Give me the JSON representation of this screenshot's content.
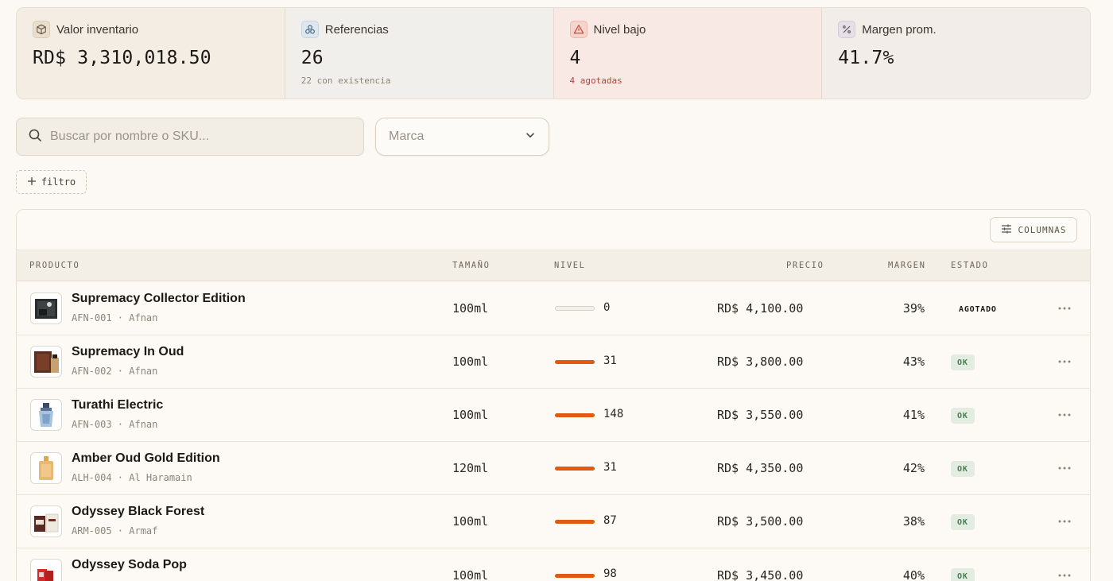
{
  "stats": [
    {
      "label": "Valor inventario",
      "value": "RD$ 3,310,018.50",
      "sub": "",
      "icon": "box-icon"
    },
    {
      "label": "Referencias",
      "value": "26",
      "sub": "22 con existencia",
      "icon": "boxes-icon"
    },
    {
      "label": "Nivel bajo",
      "value": "4",
      "sub": "4 agotadas",
      "icon": "alert-triangle-icon"
    },
    {
      "label": "Margen prom.",
      "value": "41.7%",
      "sub": "",
      "icon": "percent-icon"
    }
  ],
  "search": {
    "placeholder": "Buscar por nombre o SKU...",
    "icon": "search-icon"
  },
  "brand_select": {
    "placeholder": "Marca",
    "icon": "chevron-down-icon"
  },
  "filter_button": {
    "label": "filtro",
    "icon": "plus-icon"
  },
  "columns_button": {
    "label": "COLUMNAS",
    "icon": "sliders-icon"
  },
  "table": {
    "headers": {
      "product": "PRODUCTO",
      "size": "TAMAÑO",
      "level": "NIVEL",
      "price": "PRECIO",
      "margin": "MARGEN",
      "status": "ESTADO"
    },
    "rows": [
      {
        "name": "Supremacy Collector Edition",
        "sub": "AFN-001 · Afnan",
        "size": "100ml",
        "level": "0",
        "level_fill": 0.0,
        "price": "RD$ 4,100.00",
        "margin": "39%",
        "status": "AGOTADO",
        "status_type": "out"
      },
      {
        "name": "Supremacy In Oud",
        "sub": "AFN-002 · Afnan",
        "size": "100ml",
        "level": "31",
        "level_fill": 1.0,
        "price": "RD$ 3,800.00",
        "margin": "43%",
        "status": "OK",
        "status_type": "ok"
      },
      {
        "name": "Turathi Electric",
        "sub": "AFN-003 · Afnan",
        "size": "100ml",
        "level": "148",
        "level_fill": 1.0,
        "price": "RD$ 3,550.00",
        "margin": "41%",
        "status": "OK",
        "status_type": "ok"
      },
      {
        "name": "Amber Oud Gold Edition",
        "sub": "ALH-004 · Al Haramain",
        "size": "120ml",
        "level": "31",
        "level_fill": 1.0,
        "price": "RD$ 4,350.00",
        "margin": "42%",
        "status": "OK",
        "status_type": "ok"
      },
      {
        "name": "Odyssey Black Forest",
        "sub": "ARM-005 · Armaf",
        "size": "100ml",
        "level": "87",
        "level_fill": 1.0,
        "price": "RD$ 3,500.00",
        "margin": "38%",
        "status": "OK",
        "status_type": "ok"
      },
      {
        "name": "Odyssey Soda Pop",
        "sub": "",
        "size": "100ml",
        "level": "98",
        "level_fill": 1.0,
        "price": "RD$ 3,450.00",
        "margin": "40%",
        "status": "OK",
        "status_type": "ok"
      }
    ]
  },
  "colors": {
    "accent": "#e05a12",
    "ok_bg": "#e2ece0",
    "ok_text": "#4b7d55",
    "alert_text": "#b4453a"
  }
}
